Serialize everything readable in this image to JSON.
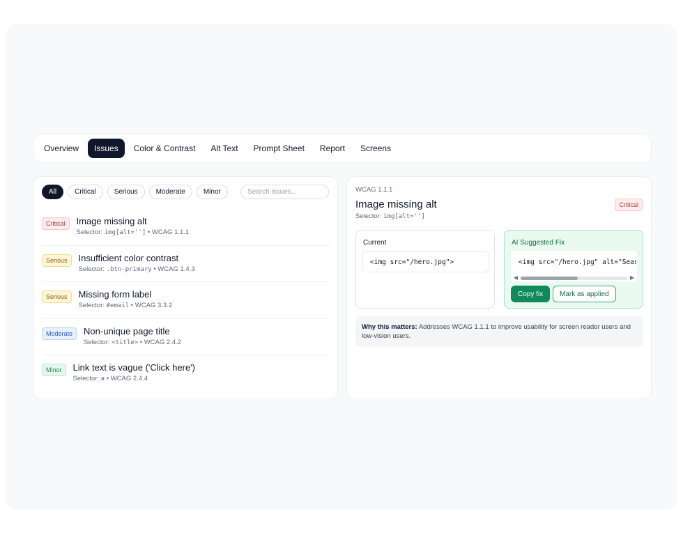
{
  "tabs": [
    "Overview",
    "Issues",
    "Color & Contrast",
    "Alt Text",
    "Prompt Sheet",
    "Report",
    "Screens"
  ],
  "active_tab": "Issues",
  "filters": [
    "All",
    "Critical",
    "Serious",
    "Moderate",
    "Minor"
  ],
  "active_filter": "All",
  "search": {
    "placeholder": "Search issues..."
  },
  "issues": [
    {
      "severity": "Critical",
      "title": "Image missing alt",
      "selector_label": "Selector:",
      "selector": "img[alt='']",
      "wcag": "WCAG 1.1.1"
    },
    {
      "severity": "Serious",
      "title": "Insufficient color contrast",
      "selector_label": "Selector:",
      "selector": ".btn-primary",
      "wcag": "WCAG 1.4.3"
    },
    {
      "severity": "Serious",
      "title": "Missing form label",
      "selector_label": "Selector:",
      "selector": "#email",
      "wcag": "WCAG 3.3.2"
    },
    {
      "severity": "Moderate",
      "title": "Non-unique page title",
      "selector_label": "Selector:",
      "selector": "<title>",
      "wcag": "WCAG 2.4.2"
    },
    {
      "severity": "Minor",
      "title": "Link text is vague ('Click here')",
      "selector_label": "Selector:",
      "selector": "a",
      "wcag": "WCAG 2.4.4"
    }
  ],
  "detail": {
    "crumb": "WCAG 1.1.1",
    "title": "Image missing alt",
    "selector_label": "Selector:",
    "selector": "img[alt='']",
    "severity": "Critical",
    "current_label": "Current",
    "current_code": "<img src=\"/hero.jpg\">",
    "fix_label": "AI Suggested Fix",
    "fix_code": "<img src=\"/hero.jpg\" alt=\"Seasonal",
    "copy_button": "Copy fix",
    "applied_button": "Mark as applied",
    "why_label": "Why this matters:",
    "why_text": "Addresses WCAG 1.1.1 to improve usability for screen reader users and low-vision users."
  },
  "colors": {
    "accent_dark": "#0f172a",
    "success": "#0f8a5c",
    "critical": "#b4393a",
    "serious": "#93650f",
    "moderate": "#2d5bb0",
    "minor": "#26834f"
  }
}
